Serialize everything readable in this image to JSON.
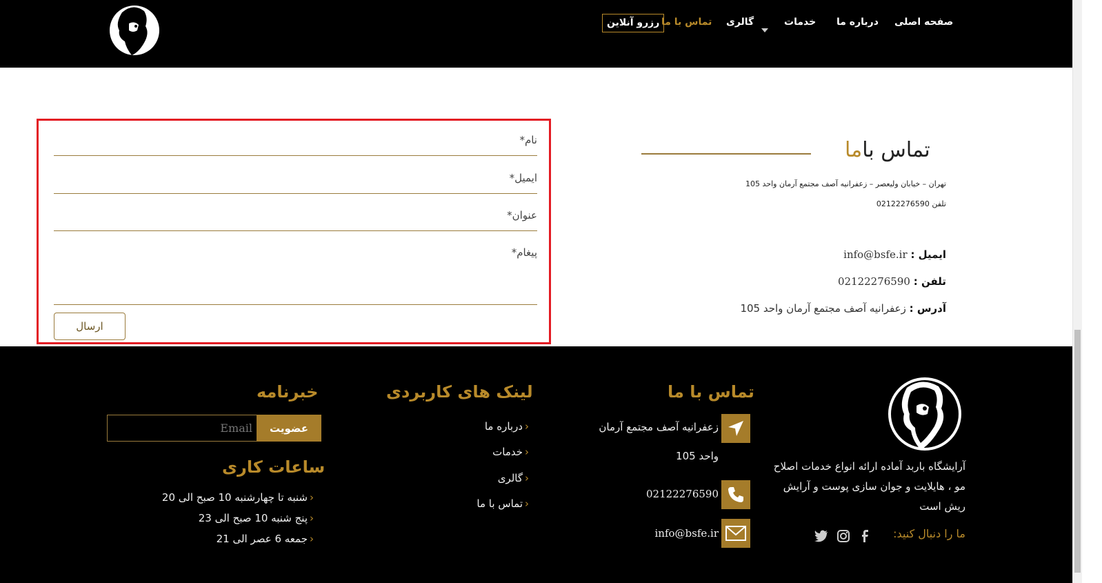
{
  "header": {
    "nav": {
      "home": "صفحه اصلی",
      "about": "درباره ما",
      "services": "خدمات",
      "gallery": "گالری",
      "contact": "تماس با ما",
      "reserve": "رزرو آنلاین"
    }
  },
  "form": {
    "name_label": "نام*",
    "email_label": "ایمیل*",
    "subject_label": "عنوان*",
    "message_label": "پیغام*",
    "submit_label": "ارسال"
  },
  "contact": {
    "title_main": "تماس با",
    "title_accent": "ما",
    "address_line": "تهران – خیابان ولیعصر – زعفرانیه آصف مجتمع آرمان واحد 105",
    "phone_line": "تلفن 02122276590",
    "email_label": "ایمیل :",
    "email_value": "info@bsfe.ir",
    "phone_label": "تلفن :",
    "phone_value": "02122276590",
    "address_label": "آدرس :",
    "address_value": "زعفرانیه آصف مجتمع آرمان واحد 105"
  },
  "footer": {
    "about_text": "آرایشگاه باربد آماده ارائه انواع خدمات اصلاح مو ، هایلایت و جوان سازی پوست و آرایش ریش است",
    "follow_label": "ما را دنبال کنید:",
    "contact_heading": "تماس با ما",
    "address_line1": "زعفرانیه آصف مجتمع آرمان",
    "address_line2": "واحد 105",
    "phone": "02122276590",
    "email": "info@bsfe.ir",
    "links_heading": "لینک های کاربردی",
    "links": [
      "درباره ما",
      "خدمات",
      "گالری",
      "تماس با ما"
    ],
    "newsletter_heading": "خبرنامه",
    "newsletter_placeholder": "Email",
    "newsletter_button": "عضویت",
    "hours_heading": "ساعات کاری",
    "hours": [
      "شنبه تا چهارشنبه 10 صبح الی 20",
      "پنج شنبه 10 صبح الی 23",
      "جمعه 6 عصر الی 21"
    ]
  },
  "colors": {
    "accent": "#b88a2a",
    "highlight_border": "#e31b23"
  }
}
